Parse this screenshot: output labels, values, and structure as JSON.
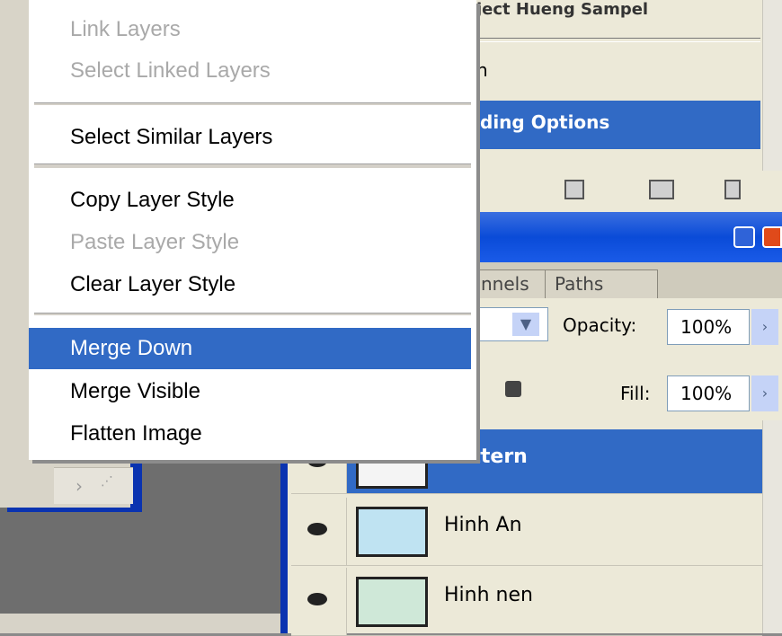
{
  "styles_panel": {
    "header_text": "ject Hueng Sampel",
    "row_partial": "n",
    "blending_options": "ding Options"
  },
  "layers_panel": {
    "tabs": [
      "nnels",
      "Paths"
    ],
    "opacity_label": "Opacity:",
    "opacity_value": "100%",
    "fill_label": "Fill:",
    "fill_value": "100%",
    "layers": [
      {
        "name": "Pattern",
        "selected": true
      },
      {
        "name": "Hinh An",
        "selected": false
      },
      {
        "name": "Hinh nen",
        "selected": false
      }
    ]
  },
  "context_menu": {
    "items": [
      {
        "label": "Link Layers",
        "enabled": false
      },
      {
        "label": "Select Linked Layers",
        "enabled": false
      },
      {
        "label": "Select Similar Layers",
        "enabled": true
      },
      {
        "label": "Copy Layer Style",
        "enabled": true
      },
      {
        "label": "Paste Layer Style",
        "enabled": false
      },
      {
        "label": "Clear Layer Style",
        "enabled": true
      },
      {
        "label": "Merge Down",
        "enabled": true,
        "highlighted": true
      },
      {
        "label": "Merge Visible",
        "enabled": true
      },
      {
        "label": "Flatten Image",
        "enabled": true
      }
    ]
  },
  "colors": {
    "highlight": "#316ac5",
    "titlebar": "#0a4bd8",
    "disabled_text": "#a9a9a9"
  },
  "icons": [
    "eye-icon",
    "lock-icon",
    "dropdown-arrow-icon",
    "minimize-icon",
    "close-icon",
    "trash-icon",
    "new-layer-icon",
    "camera-icon"
  ]
}
